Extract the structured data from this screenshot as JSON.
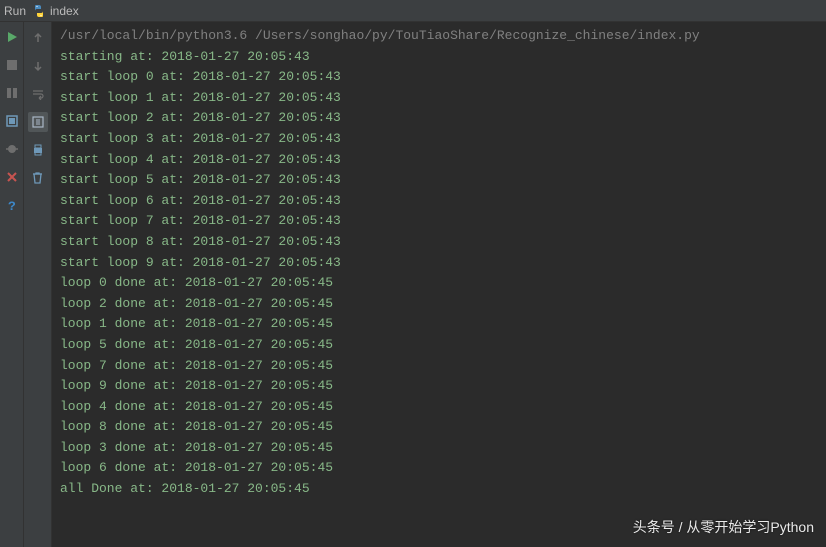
{
  "tab": {
    "run_label": "Run",
    "script_name": "index"
  },
  "console": {
    "header": "/usr/local/bin/python3.6 /Users/songhao/py/TouTiaoShare/Recognize_chinese/index.py",
    "lines": [
      "starting at: 2018-01-27 20:05:43",
      "start loop 0 at: 2018-01-27 20:05:43",
      "start loop 1 at: 2018-01-27 20:05:43",
      "start loop 2 at: 2018-01-27 20:05:43",
      "start loop 3 at: 2018-01-27 20:05:43",
      "start loop 4 at: 2018-01-27 20:05:43",
      "start loop 5 at: 2018-01-27 20:05:43",
      "start loop 6 at: 2018-01-27 20:05:43",
      "start loop 7 at: 2018-01-27 20:05:43",
      "start loop 8 at: 2018-01-27 20:05:43",
      "start loop 9 at: 2018-01-27 20:05:43",
      "loop 0 done at: 2018-01-27 20:05:45",
      "loop 2 done at: 2018-01-27 20:05:45",
      "loop 1 done at: 2018-01-27 20:05:45",
      "loop 5 done at: 2018-01-27 20:05:45",
      "loop 7 done at: 2018-01-27 20:05:45",
      "loop 9 done at: 2018-01-27 20:05:45",
      "loop 4 done at: 2018-01-27 20:05:45",
      "loop 8 done at: 2018-01-27 20:05:45",
      "loop 3 done at: 2018-01-27 20:05:45",
      "loop 6 done at: 2018-01-27 20:05:45",
      "all Done at: 2018-01-27 20:05:45"
    ]
  },
  "watermark": "头条号 / 从零开始学习Python"
}
